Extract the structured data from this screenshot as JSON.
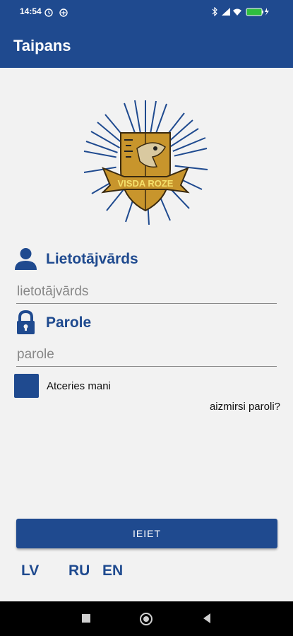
{
  "status_bar": {
    "time": "14:54"
  },
  "app_bar": {
    "title": "Taipans"
  },
  "logo": {
    "text": "VISDA ROZE"
  },
  "username": {
    "label": "Lietotājvārds",
    "placeholder": "lietotājvārds",
    "value": ""
  },
  "password": {
    "label": "Parole",
    "placeholder": "parole",
    "value": ""
  },
  "remember": {
    "label": "Atceries mani",
    "checked": false
  },
  "forgot": {
    "label": "aizmirsi paroli?"
  },
  "login_button": {
    "label": "IEIET"
  },
  "languages": {
    "lv": "LV",
    "ru": "RU",
    "en": "EN"
  },
  "colors": {
    "primary": "#1f4a8f",
    "background": "#f2f2f2",
    "logo_gold": "#c8952c"
  }
}
